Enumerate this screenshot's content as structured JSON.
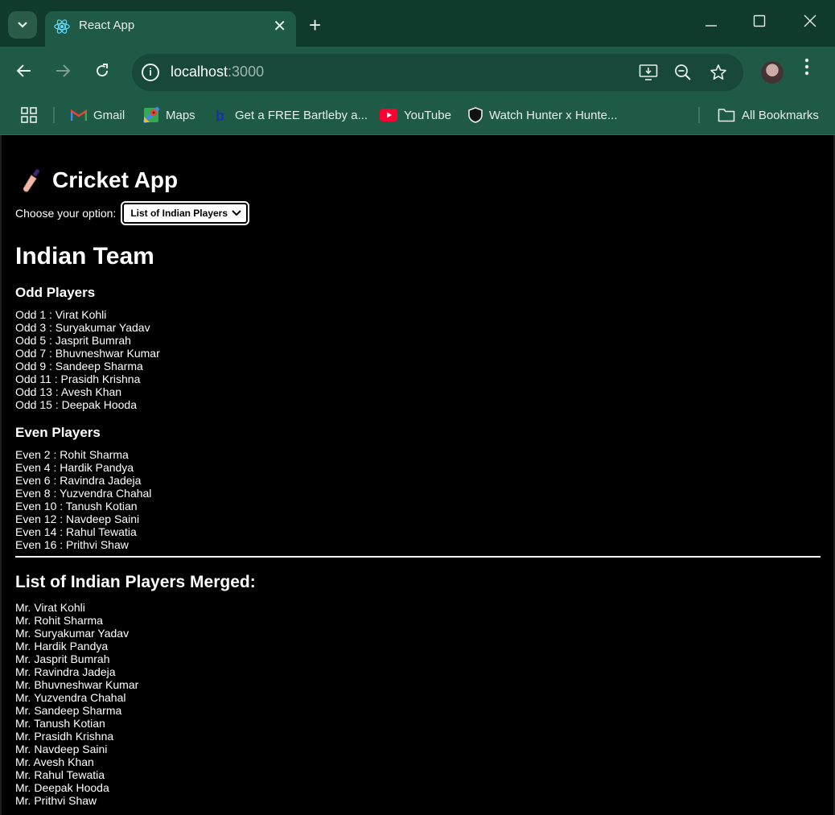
{
  "browser": {
    "tab_title": "React App",
    "url_host": "localhost",
    "url_port": ":3000",
    "bookmarks": [
      {
        "label": "Gmail",
        "icon": "gmail-icon"
      },
      {
        "label": "Maps",
        "icon": "maps-icon"
      },
      {
        "label": "Get a FREE Bartleby a...",
        "icon": "bartleby-icon"
      },
      {
        "label": "YouTube",
        "icon": "youtube-icon"
      },
      {
        "label": "Watch Hunter x Hunte...",
        "icon": "shield-icon"
      }
    ],
    "all_bookmarks": "All Bookmarks"
  },
  "app": {
    "title": "Cricket App",
    "choose_label": "Choose your option:",
    "select_value": "List of Indian Players",
    "team_heading": "Indian Team",
    "odd_heading": "Odd Players",
    "even_heading": "Even Players",
    "odd_players": [
      "Odd 1 : Virat Kohli",
      "Odd 3 : Suryakumar Yadav",
      "Odd 5 : Jasprit Bumrah",
      "Odd 7 : Bhuvneshwar Kumar",
      "Odd 9 : Sandeep Sharma",
      "Odd 11 : Prasidh Krishna",
      "Odd 13 : Avesh Khan",
      "Odd 15 : Deepak Hooda"
    ],
    "even_players": [
      "Even 2 : Rohit Sharma",
      "Even 4 : Hardik Pandya",
      "Even 6 : Ravindra Jadeja",
      "Even 8 : Yuzvendra Chahal",
      "Even 10 : Tanush Kotian",
      "Even 12 : Navdeep Saini",
      "Even 14 : Rahul Tewatia",
      "Even 16 : Prithvi Shaw"
    ],
    "merged_heading": "List of Indian Players Merged:",
    "merged_players": [
      "Mr. Virat Kohli",
      "Mr. Rohit Sharma",
      "Mr. Suryakumar Yadav",
      "Mr. Hardik Pandya",
      "Mr. Jasprit Bumrah",
      "Mr. Ravindra Jadeja",
      "Mr. Bhuvneshwar Kumar",
      "Mr. Yuzvendra Chahal",
      "Mr. Sandeep Sharma",
      "Mr. Tanush Kotian",
      "Mr. Prasidh Krishna",
      "Mr. Navdeep Saini",
      "Mr. Avesh Khan",
      "Mr. Rahul Tewatia",
      "Mr. Deepak Hooda",
      "Mr. Prithvi Shaw"
    ]
  }
}
